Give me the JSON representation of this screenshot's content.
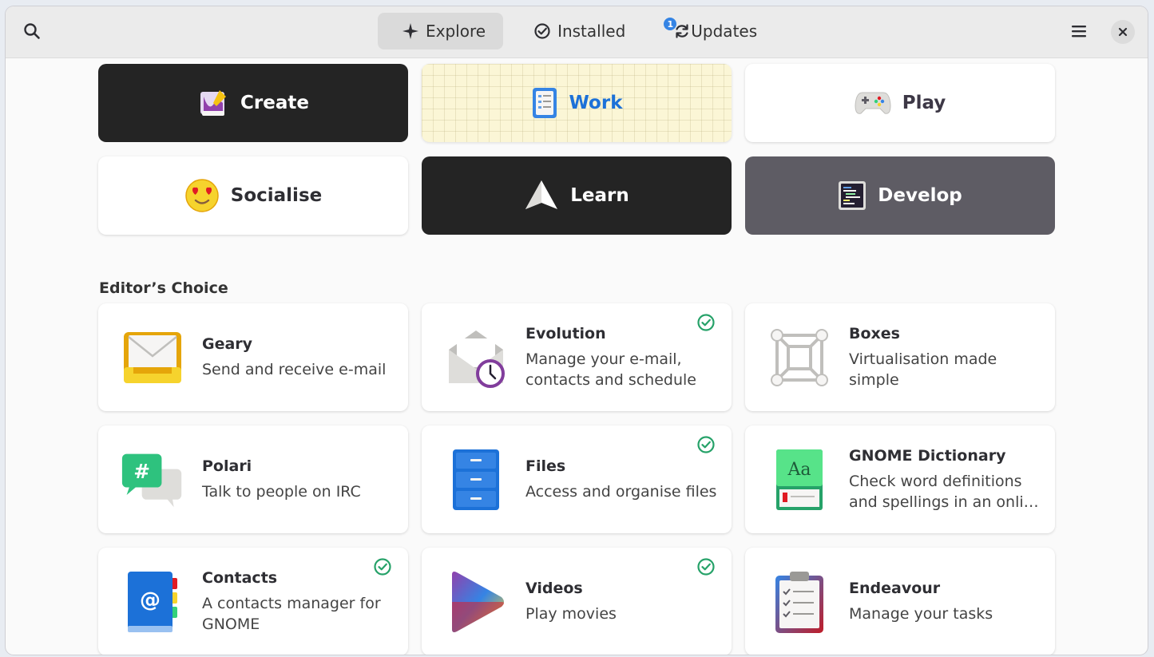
{
  "header": {
    "tabs": [
      {
        "label": "Explore",
        "icon": "explore-icon",
        "active": true
      },
      {
        "label": "Installed",
        "icon": "installed-check-icon",
        "active": false
      },
      {
        "label": "Updates",
        "icon": "updates-refresh-icon",
        "active": false,
        "badge": "1"
      }
    ]
  },
  "categories": [
    {
      "label": "Create",
      "icon": "create-paint-icon",
      "style": "dark"
    },
    {
      "label": "Work",
      "icon": "work-clipboard-icon",
      "style": "work"
    },
    {
      "label": "Play",
      "icon": "gamepad-icon",
      "style": "light"
    },
    {
      "label": "Socialise",
      "icon": "heart-eyes-emoji-icon",
      "style": "light"
    },
    {
      "label": "Learn",
      "icon": "paper-plane-icon",
      "style": "dark"
    },
    {
      "label": "Develop",
      "icon": "terminal-code-icon",
      "style": "grey"
    }
  ],
  "editors_choice": {
    "title": "Editor’s Choice",
    "apps": [
      {
        "name": "Geary",
        "description": "Send and receive e-mail",
        "icon": "geary-mail-icon",
        "installed": false
      },
      {
        "name": "Evolution",
        "description": "Manage your e-mail, contacts and schedule",
        "icon": "evolution-mail-clock-icon",
        "installed": true
      },
      {
        "name": "Boxes",
        "description": "Virtualisation made simple",
        "icon": "boxes-cube-icon",
        "installed": false
      },
      {
        "name": "Polari",
        "description": "Talk to people on IRC",
        "icon": "polari-chat-icon",
        "installed": false
      },
      {
        "name": "Files",
        "description": "Access and organise files",
        "icon": "files-cabinet-icon",
        "installed": true
      },
      {
        "name": "GNOME Dictionary",
        "description": "Check word definitions and spellings in an onli…",
        "icon": "dictionary-book-icon",
        "installed": false
      },
      {
        "name": "Contacts",
        "description": "A contacts manager for GNOME",
        "icon": "contacts-book-icon",
        "installed": true
      },
      {
        "name": "Videos",
        "description": "Play movies",
        "icon": "videos-play-icon",
        "installed": true
      },
      {
        "name": "Endeavour",
        "description": "Manage your tasks",
        "icon": "endeavour-checklist-icon",
        "installed": false
      }
    ]
  },
  "colors": {
    "accent": "#3584e4",
    "installed_check": "#26a269",
    "dark_tile": "#242424",
    "grey_tile": "#5e5c64"
  }
}
